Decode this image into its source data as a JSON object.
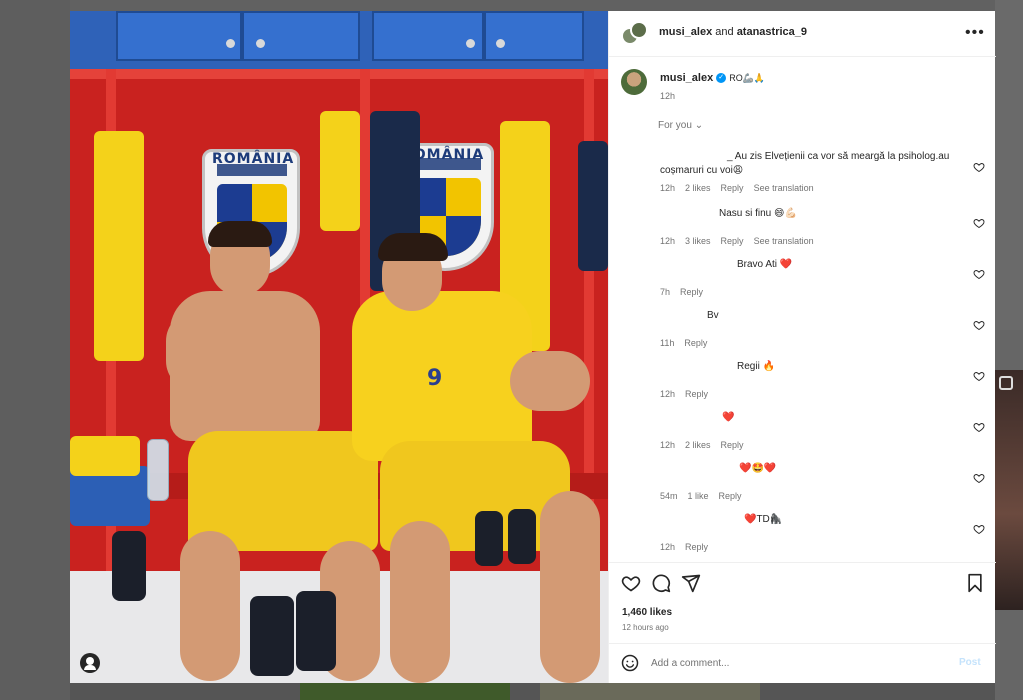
{
  "colors": {
    "primary_text": "#262626",
    "secondary_text": "#737373",
    "link_blue": "#0095f6",
    "heart_red": "#ed4956",
    "locker_red": "#c9221f"
  },
  "header": {
    "user1": "musi_alex",
    "joiner": "and",
    "user2": "atanastrica_9",
    "more_icon": "more-icon"
  },
  "caption": {
    "username": "musi_alex",
    "extra": "RO🦾🙏",
    "time": "12h"
  },
  "for_you": "For you",
  "comments": [
    {
      "text": "_ Au zis Elvețienii ca vor să meargă la psiholog.au\ncoșmaruri cu voi😩",
      "time": "12h",
      "likes": "2 likes",
      "reply": "Reply",
      "translate": "See translation"
    },
    {
      "text": "Nasu si finu 😄💪🏻",
      "time": "12h",
      "likes": "3 likes",
      "reply": "Reply",
      "translate": "See translation"
    },
    {
      "text": "Bravo Ati ❤️",
      "time": "7h",
      "likes": "",
      "reply": "Reply",
      "translate": ""
    },
    {
      "text": "Bv",
      "time": "11h",
      "likes": "",
      "reply": "Reply",
      "translate": ""
    },
    {
      "text": "Regii 🔥",
      "time": "12h",
      "likes": "",
      "reply": "Reply",
      "translate": ""
    },
    {
      "text": "❤️",
      "time": "12h",
      "likes": "2 likes",
      "reply": "Reply",
      "translate": ""
    },
    {
      "text": "❤️🤩❤️",
      "time": "54m",
      "likes": "1 like",
      "reply": "Reply",
      "translate": ""
    },
    {
      "text": "❤️TD🦍",
      "time": "12h",
      "likes": "",
      "reply": "Reply",
      "translate": ""
    }
  ],
  "footer": {
    "likes": "1,460 likes",
    "ago": "12 hours ago",
    "add_comment_placeholder": "Add a comment...",
    "post_label": "Post"
  },
  "photo": {
    "crest_text": "ROMÂNIA",
    "jersey_number": "9"
  }
}
